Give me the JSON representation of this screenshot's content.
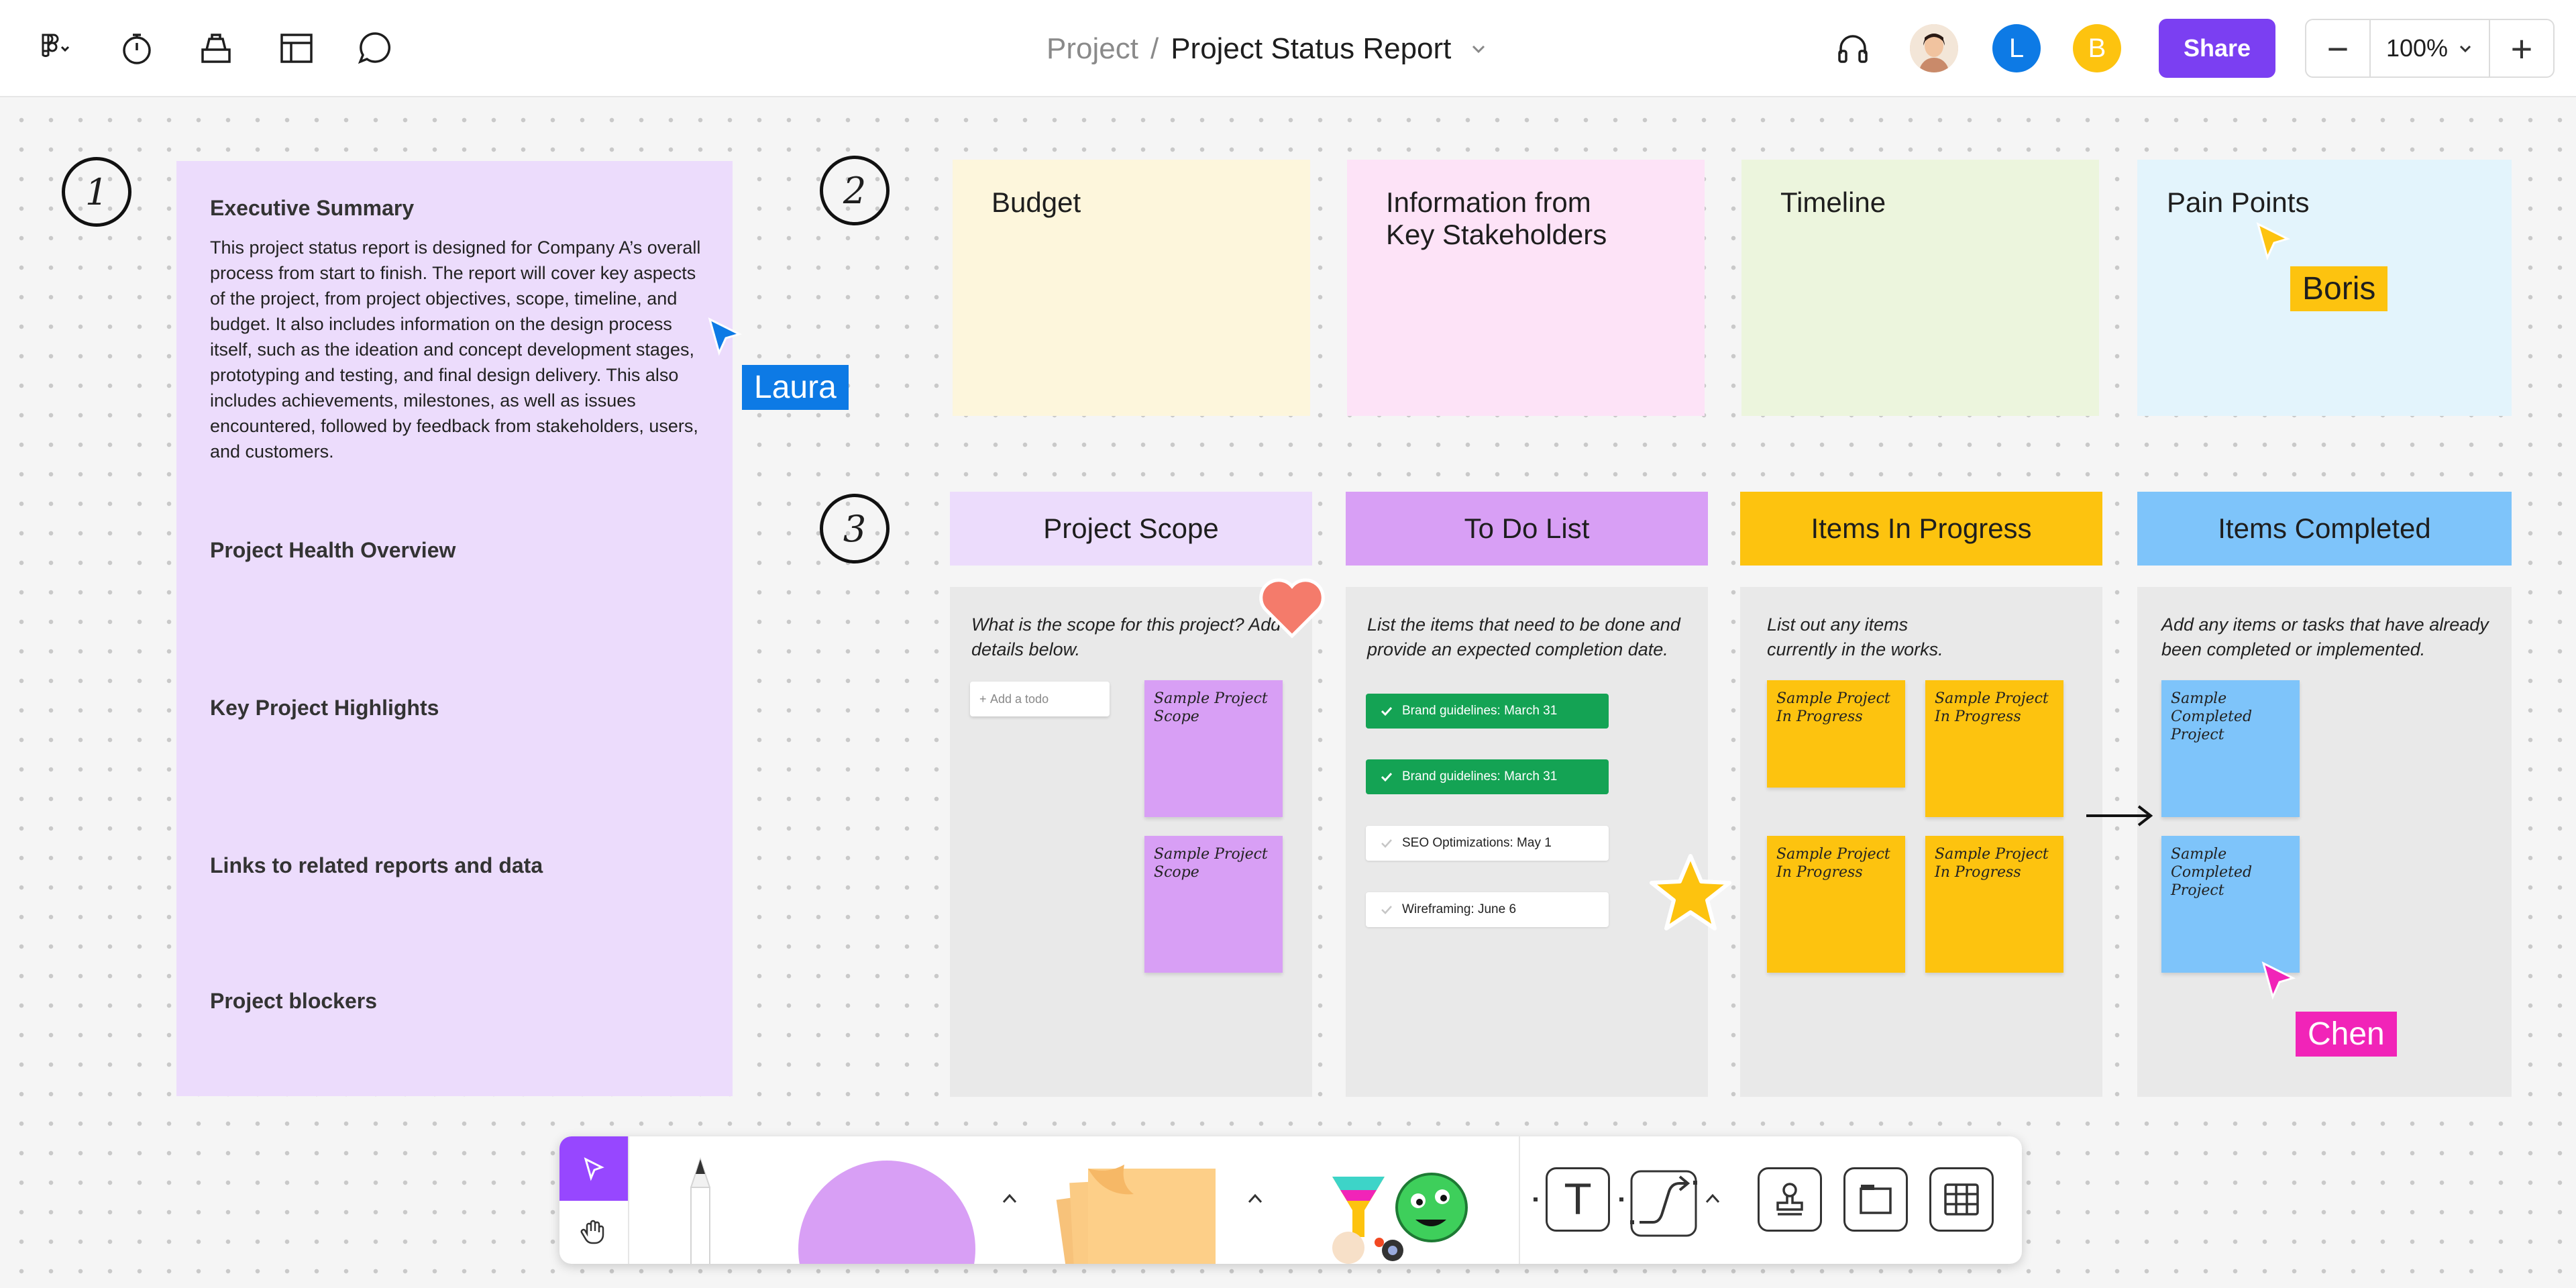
{
  "topbar": {
    "icons": [
      "figma-menu-icon",
      "timer-icon",
      "stamp-tray-icon",
      "layout-icon",
      "comment-icon"
    ],
    "breadcrumb_project": "Project",
    "breadcrumb_sep": "/",
    "doc_title": "Project Status Report",
    "avatars": [
      {
        "kind": "photo",
        "color": "#f2c9a3"
      },
      {
        "kind": "initial",
        "initial": "L",
        "color": "#0d7ae5"
      },
      {
        "kind": "initial",
        "initial": "B",
        "color": "#fdc30f"
      }
    ],
    "share_label": "Share",
    "zoom_minus": "−",
    "zoom_value": "100%",
    "zoom_plus": "+"
  },
  "sections": {
    "one": "1",
    "two": "2",
    "three": "3"
  },
  "summary": {
    "executive_title": "Executive Summary",
    "executive_body": "This project status report is designed for Company A’s overall process from start to finish. The report will cover key aspects of the project, from project objectives, scope, timeline, and budget. It also includes information on the design process itself, such as the ideation and concept development stages, prototyping and testing, and final design delivery. This also includes achievements, milestones, as well as issues encountered, followed by feedback from stakeholders, users, and customers.",
    "health": "Project Health Overview",
    "highlights": "Key Project Highlights",
    "links": "Links to related reports and data",
    "blockers": "Project blockers"
  },
  "stickies": [
    {
      "label": "Budget",
      "color": "#fdf6dc"
    },
    {
      "label": "Information from\nKey Stakeholders",
      "color": "#fde3f7"
    },
    {
      "label": "Timeline",
      "color": "#ecf5dd"
    },
    {
      "label": "Pain Points",
      "color": "#e3f4fc"
    }
  ],
  "columns": [
    {
      "title": "Project Scope",
      "color": "#ecdcfc",
      "desc": "What is the scope for this project? Add details below."
    },
    {
      "title": "To Do List",
      "color": "#d89ff5",
      "desc": "List the items that need to be done and provide an expected completion date."
    },
    {
      "title": "Items In Progress",
      "color": "#fdc30f",
      "desc": "List out any items currently in the works."
    },
    {
      "title": "Items Completed",
      "color": "#7ec4fa",
      "desc": "Add any items or tasks that have already been completed or implemented."
    }
  ],
  "scope": {
    "add_todo": "Add a todo",
    "notes": [
      "Sample Project Scope",
      "Sample Project Scope"
    ]
  },
  "todo": {
    "tasks": [
      {
        "label": "Brand guidelines: March 31",
        "done": true
      },
      {
        "label": "Brand guidelines: March 31",
        "done": true
      },
      {
        "label": "SEO Optimizations: May 1",
        "done": false
      },
      {
        "label": "Wireframing: June 6",
        "done": false
      }
    ]
  },
  "progress_notes": [
    "Sample Project In Progress",
    "Sample Project In Progress",
    "Sample Project In Progress",
    "Sample Project In Progress"
  ],
  "completed_notes": [
    "Sample Completed Project",
    "Sample Completed Project"
  ],
  "cursors": [
    {
      "name": "Laura",
      "color": "#0d7ae5"
    },
    {
      "name": "Boris",
      "color": "#fdc30f",
      "text_color": "#1e1e1e"
    },
    {
      "name": "Chen",
      "color": "#f124b8"
    }
  ],
  "stickers": [
    "heart-sticker",
    "star-sticker"
  ],
  "toolbar": {
    "tools": [
      "select-tool",
      "hand-tool",
      "pencil-tool",
      "shape-tool",
      "sticky-note-tool",
      "sticker-tool",
      "text-tool",
      "connector-tool",
      "stamp-tool",
      "section-tool",
      "table-tool"
    ],
    "text_tool_glyph": "T",
    "accent": "#9747ff"
  }
}
